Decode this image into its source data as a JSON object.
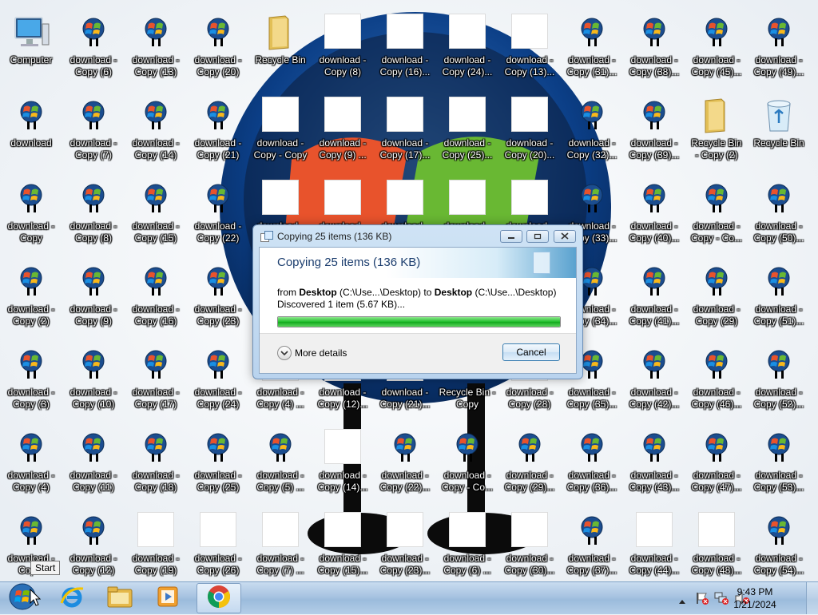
{
  "desktop": {
    "icons": [
      {
        "label": "Computer",
        "type": "computer"
      },
      {
        "label": "download -\nCopy (6)",
        "type": "download"
      },
      {
        "label": "download -\nCopy (13)",
        "type": "download"
      },
      {
        "label": "download -\nCopy (20)",
        "type": "download"
      },
      {
        "label": "Recycle Bin",
        "type": "folder"
      },
      {
        "label": "download -\nCopy (8)",
        "type": "thumb"
      },
      {
        "label": "download -\nCopy (16)...",
        "type": "thumb"
      },
      {
        "label": "download -\nCopy (24)...",
        "type": "thumb"
      },
      {
        "label": "download -\nCopy (13)...",
        "type": "thumb"
      },
      {
        "label": "download -\nCopy (31)...",
        "type": "download"
      },
      {
        "label": "download -\nCopy (38)...",
        "type": "download"
      },
      {
        "label": "download -\nCopy (45)...",
        "type": "download"
      },
      {
        "label": "download -\nCopy (49)...",
        "type": "download"
      },
      {
        "label": "download",
        "type": "download"
      },
      {
        "label": "download -\nCopy (7)",
        "type": "download"
      },
      {
        "label": "download -\nCopy (14)",
        "type": "download"
      },
      {
        "label": "download -\nCopy (21)",
        "type": "download"
      },
      {
        "label": "download -\nCopy - Copy",
        "type": "thumb"
      },
      {
        "label": "download -\nCopy (9) ...",
        "type": "thumb"
      },
      {
        "label": "download -\nCopy (17)...",
        "type": "thumb"
      },
      {
        "label": "download -\nCopy (25)...",
        "type": "thumb"
      },
      {
        "label": "download -\nCopy (20)...",
        "type": "thumb"
      },
      {
        "label": "download -\nCopy (32)...",
        "type": "download"
      },
      {
        "label": "download -\nCopy (39)...",
        "type": "download"
      },
      {
        "label": "Recycle Bin\n- Copy (2)",
        "type": "folder"
      },
      {
        "label": "Recycle Bin",
        "type": "recycle"
      },
      {
        "label": "download -\nCopy",
        "type": "download"
      },
      {
        "label": "download -\nCopy (8)",
        "type": "download"
      },
      {
        "label": "download -\nCopy (15)",
        "type": "download"
      },
      {
        "label": "download -\nCopy (22)",
        "type": "download"
      },
      {
        "label": "download -",
        "type": "thumb"
      },
      {
        "label": "download -",
        "type": "thumb"
      },
      {
        "label": "download -",
        "type": "thumb"
      },
      {
        "label": "download -",
        "type": "thumb"
      },
      {
        "label": "download -",
        "type": "thumb"
      },
      {
        "label": "download -\nCopy (33)...",
        "type": "download"
      },
      {
        "label": "download -\nCopy (40)...",
        "type": "download"
      },
      {
        "label": "download -\nCopy - Co...",
        "type": "download"
      },
      {
        "label": "download -\nCopy (50)...",
        "type": "download"
      },
      {
        "label": "download -\nCopy (2)",
        "type": "download"
      },
      {
        "label": "download -\nCopy (9)",
        "type": "download"
      },
      {
        "label": "download -\nCopy (16)",
        "type": "download"
      },
      {
        "label": "download -\nCopy (23)",
        "type": "download"
      },
      {
        "label": "download -\nCopy (34)...",
        "type": "download"
      },
      {
        "label": "download -\nCopy (41)...",
        "type": "download"
      },
      {
        "label": "download -\nCopy (29)",
        "type": "download"
      },
      {
        "label": "download -\nCopy (51)...",
        "type": "download"
      },
      {
        "label": "download -\nCopy (3)",
        "type": "download"
      },
      {
        "label": "download -\nCopy (10)",
        "type": "download"
      },
      {
        "label": "download -\nCopy (17)",
        "type": "download"
      },
      {
        "label": "download -\nCopy (24)",
        "type": "download"
      },
      {
        "label": "download -\nCopy (4) ...",
        "type": "thumb"
      },
      {
        "label": "download -\nCopy (12)...",
        "type": "thumb"
      },
      {
        "label": "download -\nCopy (21)...",
        "type": "thumb"
      },
      {
        "label": "Recycle Bin -\nCopy",
        "type": "none"
      },
      {
        "label": "download -\nCopy (28)",
        "type": "thumb"
      },
      {
        "label": "download -\nCopy (35)...",
        "type": "download"
      },
      {
        "label": "download -\nCopy (42)...",
        "type": "download"
      },
      {
        "label": "download -\nCopy (46)...",
        "type": "download"
      },
      {
        "label": "download -\nCopy (52)...",
        "type": "download"
      },
      {
        "label": "download -\nCopy (4)",
        "type": "download"
      },
      {
        "label": "download -\nCopy (11)",
        "type": "download"
      },
      {
        "label": "download -\nCopy (18)",
        "type": "download"
      },
      {
        "label": "download -\nCopy (25)",
        "type": "download"
      },
      {
        "label": "download -\nCopy (5) ...",
        "type": "download"
      },
      {
        "label": "download -\nCopy (14)...",
        "type": "thumb"
      },
      {
        "label": "download -\nCopy (22)...",
        "type": "download"
      },
      {
        "label": "download -\nCopy - Co...",
        "type": "download"
      },
      {
        "label": "download -\nCopy (29)...",
        "type": "download"
      },
      {
        "label": "download -\nCopy (36)...",
        "type": "download"
      },
      {
        "label": "download -\nCopy (43)...",
        "type": "download"
      },
      {
        "label": "download -\nCopy (47)...",
        "type": "download"
      },
      {
        "label": "download -\nCopy (53)...",
        "type": "download"
      },
      {
        "label": "download -\nCop...",
        "type": "download"
      },
      {
        "label": "download -\nCopy (12)",
        "type": "download"
      },
      {
        "label": "download -\nCopy (19)",
        "type": "thumb"
      },
      {
        "label": "download -\nCopy (26)",
        "type": "thumb"
      },
      {
        "label": "download -\nCopy (7) ...",
        "type": "thumb"
      },
      {
        "label": "download -\nCopy (15)...",
        "type": "thumb"
      },
      {
        "label": "download -\nCopy (23)...",
        "type": "thumb"
      },
      {
        "label": "download -\nCopy (6) ...",
        "type": "thumb"
      },
      {
        "label": "download -\nCopy (30)...",
        "type": "thumb"
      },
      {
        "label": "download -\nCopy (37)...",
        "type": "download"
      },
      {
        "label": "download -\nCopy (44)...",
        "type": "thumb"
      },
      {
        "label": "download -\nCopy (48)...",
        "type": "thumb"
      },
      {
        "label": "download -\nCopy (54)...",
        "type": "download"
      }
    ]
  },
  "dialog": {
    "title": "Copying 25 items (136 KB)",
    "header": "Copying 25 items (136 KB)",
    "from_word": "from",
    "from_name": "Desktop",
    "from_path": "(C:\\Use...\\Desktop)",
    "to_word": "to",
    "to_name": "Desktop",
    "to_path": "(C:\\Use...\\Desktop)",
    "discovered": "Discovered 1 item (5.67 KB)...",
    "progress_fraction": 1.0,
    "more_details": "More details",
    "cancel": "Cancel"
  },
  "taskbar": {
    "start_tooltip": "Start",
    "time": "9:43 PM",
    "date": "1/21/2024"
  },
  "colors": {
    "taskbar": "#a7c3e1",
    "progress": "#1fbf2a",
    "dialog_header_text": "#1b3d6e"
  }
}
